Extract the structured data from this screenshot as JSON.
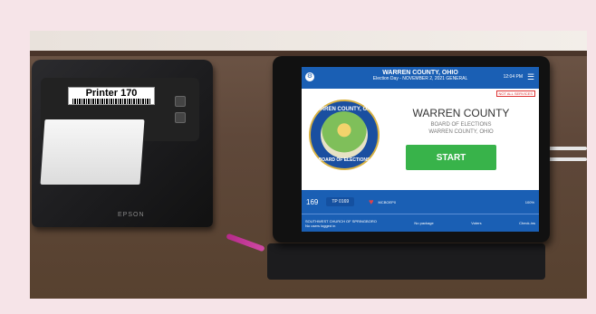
{
  "printer": {
    "label": "Printer 170",
    "brand": "EPSON"
  },
  "tablet_screen": {
    "header": {
      "title": "WARREN COUNTY, OHIO",
      "subtitle": "Election Day - NOVEMBER 2, 2021 GENERAL",
      "time": "12:04 PM"
    },
    "alert_badge": "NOT ALL SERVICES",
    "seal": {
      "top_text": "WARREN COUNTY, OHIO",
      "bottom_text": "BOARD OF ELECTIONS"
    },
    "county_name": "WARREN COUNTY",
    "board_line1": "BOARD OF ELECTIONS",
    "board_line2": "WARREN COUNTY, OHIO",
    "start_label": "START",
    "stats": {
      "left_value": "169",
      "precinct_value": "TP 0169",
      "middle_text": "MCBOEP0",
      "percent": "100%"
    },
    "footer": {
      "location": "SOUTHWEST CHURCH OF SPRINGBORO",
      "status": "No users logged in",
      "no_package": "No package",
      "voters_label": "Voters",
      "checkins_label": "Check-ins"
    }
  },
  "colors": {
    "screen_blue": "#1a5fb4",
    "start_green": "#38b34a",
    "pen_magenta": "#c03a97"
  }
}
